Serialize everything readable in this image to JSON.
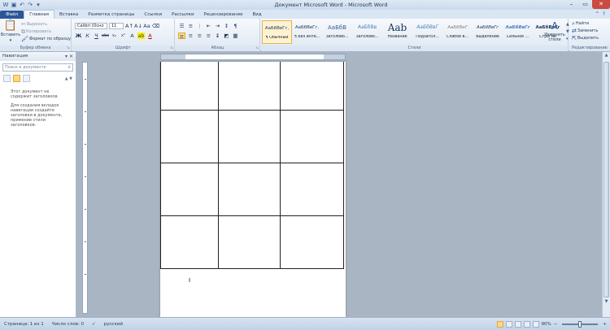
{
  "window": {
    "title": "Документ Microsoft Word - Microsoft Word"
  },
  "qat": {
    "icons": [
      "word-logo-icon",
      "save-icon",
      "undo-icon",
      "redo-icon",
      "customize-icon"
    ]
  },
  "tabs": [
    {
      "label": "Файл",
      "name": "tab-file"
    },
    {
      "label": "Главная",
      "name": "tab-home"
    },
    {
      "label": "Вставка",
      "name": "tab-insert"
    },
    {
      "label": "Разметка страницы",
      "name": "tab-page-layout"
    },
    {
      "label": "Ссылки",
      "name": "tab-references"
    },
    {
      "label": "Рассылки",
      "name": "tab-mailings"
    },
    {
      "label": "Рецензирование",
      "name": "tab-review"
    },
    {
      "label": "Вид",
      "name": "tab-view"
    }
  ],
  "ribbon": {
    "clipboard": {
      "label": "Буфер обмена",
      "paste": "Вставить",
      "cut": "Вырезать",
      "copy": "Копировать",
      "format_painter": "Формат по образцу"
    },
    "font": {
      "label": "Шрифт",
      "font_name": "Calibri (Осно",
      "font_size": "11",
      "bold": "Ж",
      "italic": "К",
      "underline": "Ч",
      "strike": "abc",
      "sub": "x₂",
      "sup": "x²"
    },
    "paragraph": {
      "label": "Абзац"
    },
    "styles": {
      "label": "Стили",
      "items": [
        {
          "preview": "АаБбВвГг,",
          "name": "¶ Обычный",
          "selected": true
        },
        {
          "preview": "АаБбВвГг,",
          "name": "¶ Без инте..."
        },
        {
          "preview": "АаБбВ",
          "name": "Заголово..."
        },
        {
          "preview": "АаБбВв",
          "name": "Заголово..."
        },
        {
          "preview": "Aab",
          "name": "Название"
        },
        {
          "preview": "АаБбВвГ",
          "name": "Подзагол..."
        },
        {
          "preview": "АаБбВеГ",
          "name": "Слабое в..."
        },
        {
          "preview": "АаБбВвГг",
          "name": "Выделение"
        },
        {
          "preview": "АаБбВвГг",
          "name": "Сильное ..."
        },
        {
          "preview": "АаБбВвГг",
          "name": "Строгий"
        }
      ],
      "change_styles": "Изменить стили"
    },
    "editing": {
      "label": "Редактирование",
      "find": "Найти",
      "replace": "Заменить",
      "select": "Выделить"
    }
  },
  "nav": {
    "title": "Навигация",
    "search_placeholder": "Поиск в документе",
    "text1": "Этот документ не содержит заголовков.",
    "text2": "Для создания вкладок навигации создайте заголовки в документе, применив стили заголовков."
  },
  "status": {
    "page": "Страница: 1 из 1",
    "words": "Число слов: 0",
    "language": "русский",
    "zoom": "90%"
  },
  "colors": {
    "file_tab": "#2b5797",
    "close_button": "#c94b42",
    "highlight": "#fcd788"
  }
}
